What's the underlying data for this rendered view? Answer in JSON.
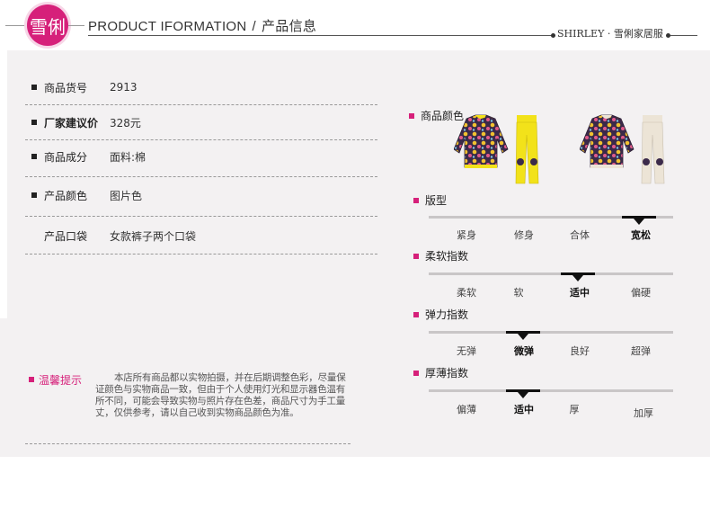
{
  "header": {
    "logo_text": "雪俐",
    "title_en": "PRODUCT IFORMATION",
    "title_sep": "/",
    "title_cn": "产品信息",
    "brand": "SHIRLEY · 雪俐家居服"
  },
  "specs": [
    {
      "key": "商品货号",
      "value": "2913",
      "bold": false,
      "bullet": true
    },
    {
      "key": "厂家建议价",
      "value": "328元",
      "bold": true,
      "bullet": true
    },
    {
      "key": "商品成分",
      "value": "面料:棉",
      "bold": false,
      "bullet": true
    },
    {
      "key": "产品颜色",
      "value": "图片色",
      "bold": false,
      "bullet": true
    },
    {
      "key": "产品口袋",
      "value": "女款裤子两个口袋",
      "bold": false,
      "bullet": false
    }
  ],
  "notice": {
    "title": "温馨提示",
    "body": "本店所有商品都以实物拍摄，并在后期调整色彩，尽量保证颜色与实物商品一致，但由于个人使用灯光和显示器色温有所不同，可能会导致实物与照片存在色差，商品尺寸为手工量丈，仅供参考，请以自己收到实物商品颜色为准。"
  },
  "color_section": {
    "label": "商品颜色",
    "variants": [
      {
        "top": "floral-purple",
        "pants": "yellow",
        "pants_color": "#f2e21a"
      },
      {
        "top": "floral-purple",
        "pants": "cream",
        "pants_color": "#ece4d6"
      }
    ]
  },
  "scales": [
    {
      "label": "版型",
      "options": [
        "紧身",
        "修身",
        "合体",
        "宽松"
      ],
      "selected": 3
    },
    {
      "label": "柔软指数",
      "options": [
        "柔软",
        "软",
        "适中",
        "偏硬"
      ],
      "selected": 2
    },
    {
      "label": "弹力指数",
      "options": [
        "无弹",
        "微弹",
        "良好",
        "超弹"
      ],
      "selected": 1
    },
    {
      "label": "厚薄指数",
      "options": [
        "偏薄",
        "适中",
        "厚",
        "加厚"
      ],
      "selected": 1
    }
  ],
  "colors": {
    "accent": "#d6207a",
    "panel_bg": "#f3f1f2",
    "top_bg": "#3b2a4a"
  }
}
